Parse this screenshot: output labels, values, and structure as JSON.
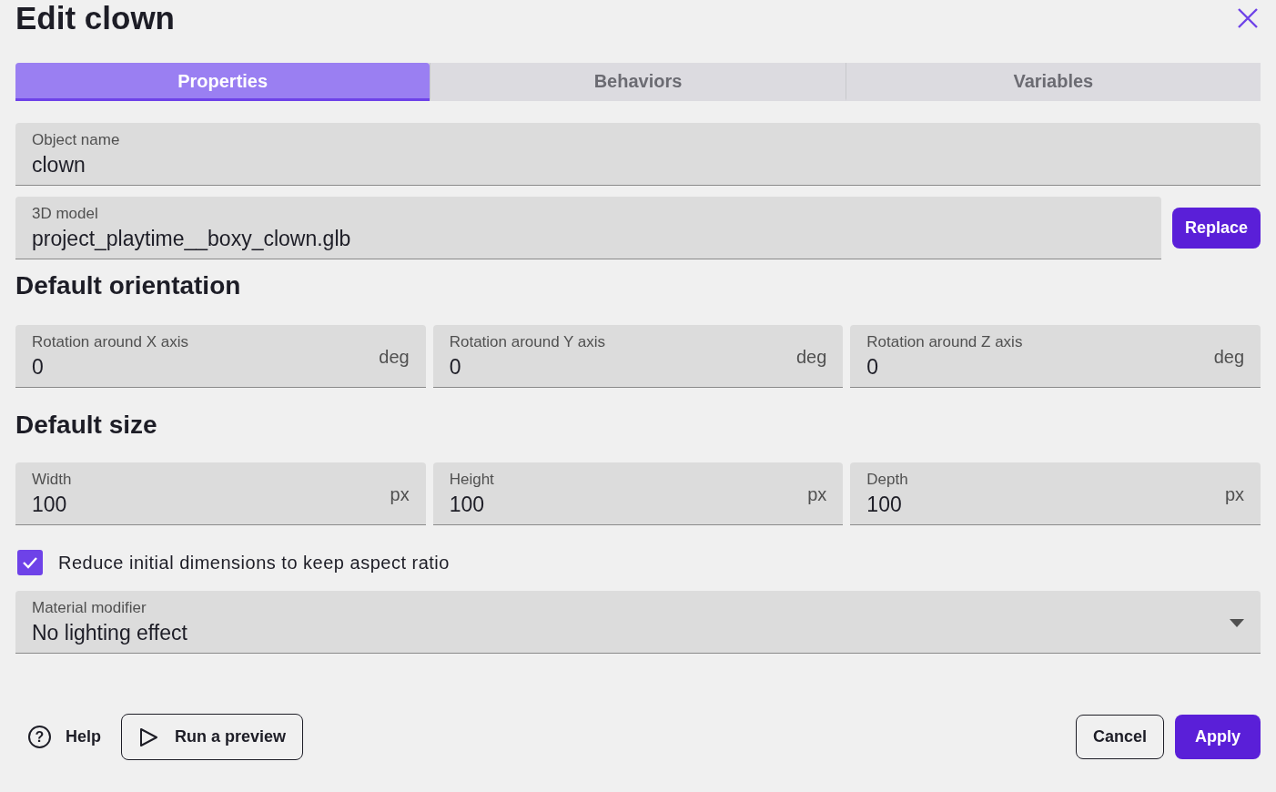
{
  "window": {
    "title": "Edit clown"
  },
  "tabs": [
    {
      "label": "Properties",
      "selected": true
    },
    {
      "label": "Behaviors",
      "selected": false
    },
    {
      "label": "Variables",
      "selected": false
    }
  ],
  "object_name": {
    "label": "Object name",
    "value": "clown"
  },
  "model": {
    "label": "3D model",
    "value": "project_playtime__boxy_clown.glb",
    "button": "Replace"
  },
  "sections": [
    {
      "heading": "Default orientation",
      "fields": [
        {
          "label": "Rotation around X axis",
          "value": "0",
          "unit": "deg"
        },
        {
          "label": "Rotation around Y axis",
          "value": "0",
          "unit": "deg"
        },
        {
          "label": "Rotation around Z axis",
          "value": "0",
          "unit": "deg"
        }
      ]
    },
    {
      "heading": "Default size",
      "fields": [
        {
          "label": "Width",
          "value": "100",
          "unit": "px"
        },
        {
          "label": "Height",
          "value": "100",
          "unit": "px"
        },
        {
          "label": "Depth",
          "value": "100",
          "unit": "px"
        }
      ]
    }
  ],
  "checkbox": {
    "label": "Reduce initial dimensions to keep aspect ratio",
    "checked": true
  },
  "material": {
    "label": "Material modifier",
    "value": "No lighting effect"
  },
  "footer": {
    "help_icon": "?",
    "help": "Help",
    "preview": "Run a preview",
    "cancel": "Cancel",
    "apply": "Apply"
  }
}
